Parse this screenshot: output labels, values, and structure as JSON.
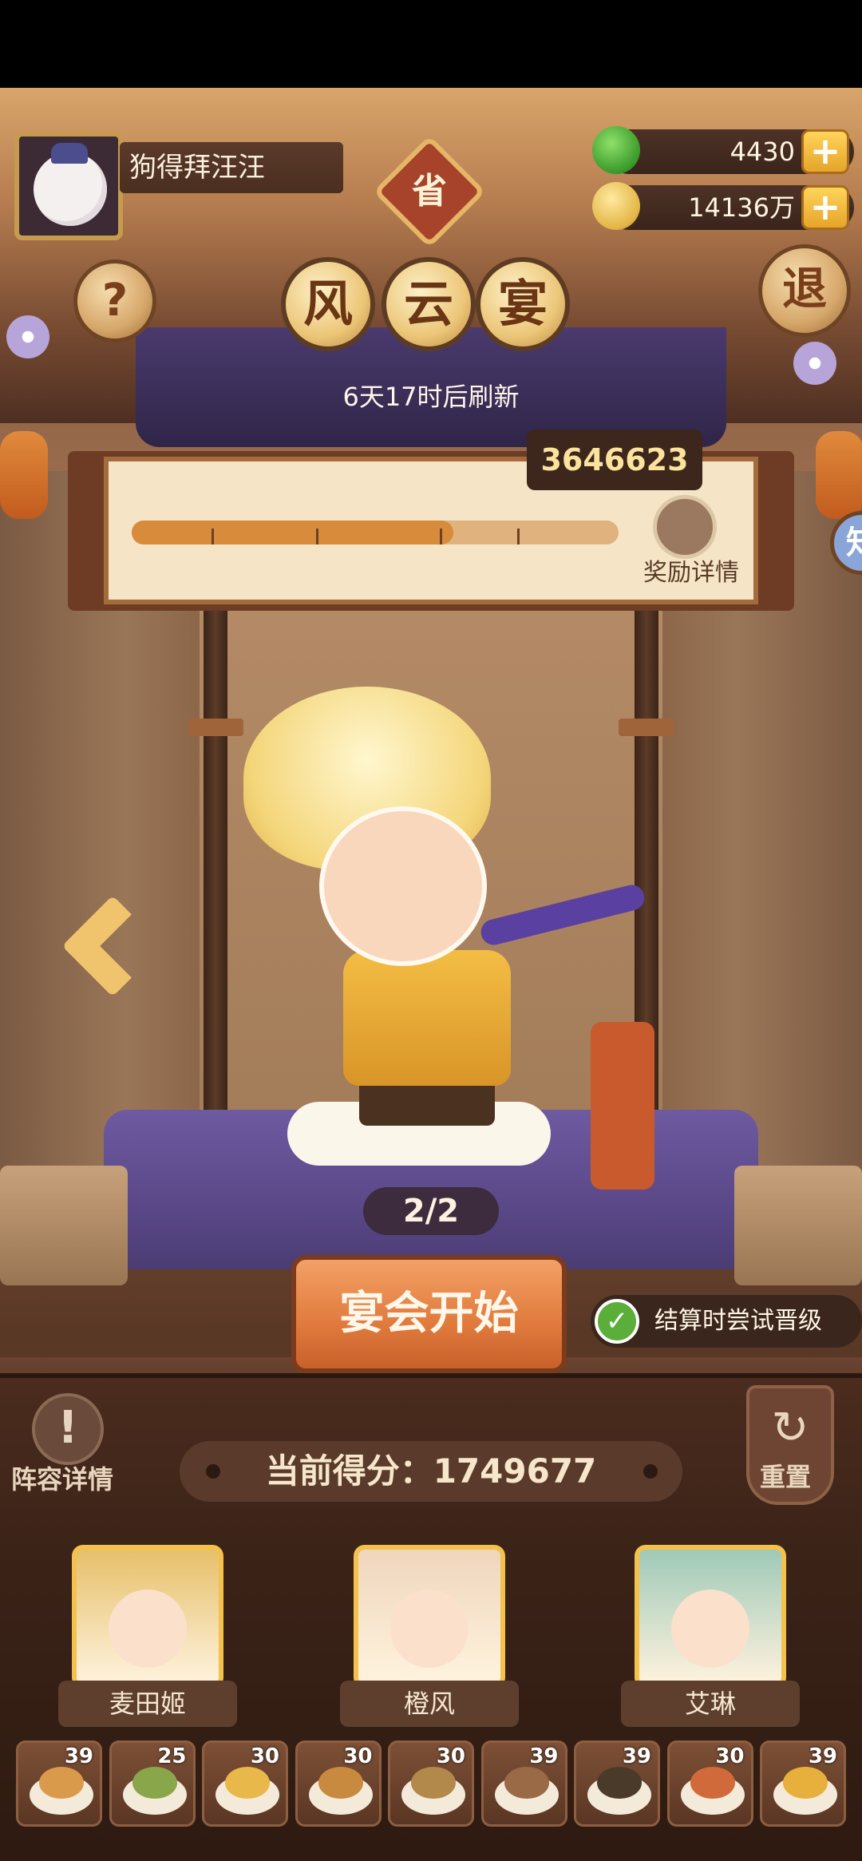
{
  "player": {
    "name": "狗得拜汪汪"
  },
  "badge": {
    "label": "省"
  },
  "resources": {
    "apples": "4430",
    "coins": "14136万",
    "plus": "+"
  },
  "buttons": {
    "help": "?",
    "exit": "退",
    "side_tab": "知"
  },
  "title": {
    "chars": [
      "风",
      "云",
      "宴"
    ]
  },
  "refresh_text": "6天17时后刷新",
  "score_board": {
    "target_score": "3646623",
    "reward_label": "奖励详情",
    "progress": 0.66
  },
  "character": {
    "page": "2/2"
  },
  "actions": {
    "start": "宴会开始",
    "auto_promote": "结算时尝试晋级",
    "lineup": "阵容详情",
    "reset": "重置"
  },
  "current_score": "当前得分：1749677",
  "heroes": [
    {
      "name": "麦田姬",
      "bg": "#e6c06a"
    },
    {
      "name": "橙风",
      "bg": "#efd6bd"
    },
    {
      "name": "艾琳",
      "bg": "#9fc9b8"
    }
  ],
  "dishes": [
    {
      "level": "39",
      "color": "#d99a4b"
    },
    {
      "level": "25",
      "color": "#8aa64a"
    },
    {
      "level": "30",
      "color": "#e8b84a"
    },
    {
      "level": "30",
      "color": "#c88a3e"
    },
    {
      "level": "30",
      "color": "#b3894b"
    },
    {
      "level": "39",
      "color": "#9a6a46"
    },
    {
      "level": "39",
      "color": "#4a3a2a"
    },
    {
      "level": "30",
      "color": "#d06a3a"
    },
    {
      "level": "39",
      "color": "#e7b03c"
    }
  ]
}
